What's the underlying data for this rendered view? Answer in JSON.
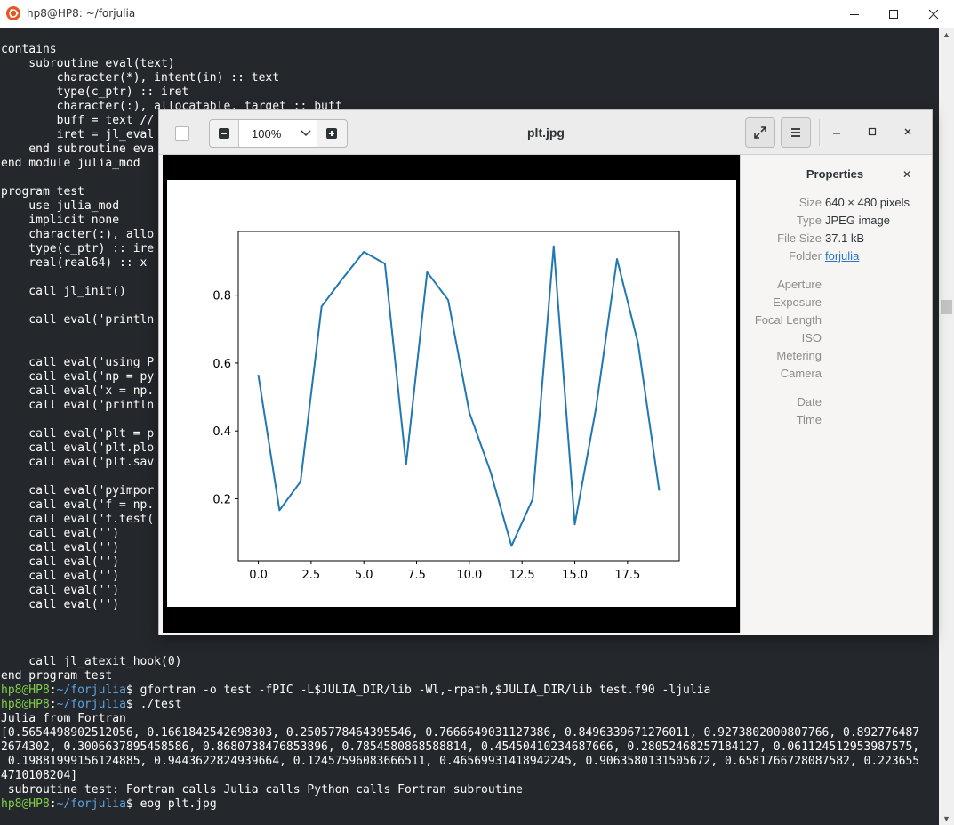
{
  "terminal": {
    "title": "hp8@HP8: ~/forjulia",
    "lines": [
      "contains",
      "    subroutine eval(text)",
      "        character(*), intent(in) :: text",
      "        type(c_ptr) :: iret",
      "        character(:), allocatable, target :: buff",
      "        buff = text //",
      "        iret = jl_eval",
      "    end subroutine eva",
      "end module julia_mod",
      "",
      "program test",
      "    use julia_mod",
      "    implicit none",
      "    character(:), allo",
      "    type(c_ptr) :: ire",
      "    real(real64) :: x",
      "",
      "    call jl_init()",
      "",
      "    call eval('println",
      "",
      "",
      "    call eval('using P",
      "    call eval('np = py",
      "    call eval('x = np.",
      "    call eval('println",
      "",
      "    call eval('plt = p",
      "    call eval('plt.plo",
      "    call eval('plt.sav",
      "",
      "    call eval('pyimpor",
      "    call eval('f = np.",
      "    call eval('f.test(",
      "    call eval('')",
      "    call eval('')",
      "    call eval('')",
      "    call eval('')",
      "    call eval('')",
      "    call eval('')",
      "",
      "",
      "",
      "    call jl_atexit_hook(0)",
      "end program test"
    ],
    "prompt_user": "hp8@HP8",
    "prompt_path": "~/forjulia",
    "prompt_suffix": "$ ",
    "cmd1": "gfortran -o test -fPIC -L$JULIA_DIR/lib -Wl,-rpath,$JULIA_DIR/lib test.f90 -ljulia",
    "cmd2": "./test",
    "output": [
      "Julia from Fortran",
      "[0.5654498902512056, 0.1661842542698303, 0.2505778464395546, 0.7666649031127386, 0.8496339671276011, 0.9273802000807766, 0.892776487",
      "2674302, 0.3006637895458586, 0.8680738476853896, 0.7854580868588814, 0.45450410234687666, 0.28052468257184127, 0.061124512953987575,",
      " 0.1988199915612488​5, 0.9443622824939664, 0.12457596083666511, 0.46569931418942245, 0.9063580131505672, 0.6581766728087582, 0.223655",
      "4710108204]",
      " subroutine test: Fortran calls Julia calls Python calls Fortran subroutine"
    ],
    "cmd3": "eog plt.jpg"
  },
  "viewer": {
    "title": "plt.jpg",
    "zoom": "100%",
    "properties_title": "Properties",
    "props": [
      {
        "label": "Size",
        "value": "640 × 480 pixels"
      },
      {
        "label": "Type",
        "value": "JPEG image"
      },
      {
        "label": "File Size",
        "value": "37.1 kB"
      },
      {
        "label": "Folder",
        "value": "forjulia"
      }
    ],
    "exif_labels": [
      "Aperture",
      "Exposure",
      "Focal Length",
      "ISO",
      "Metering",
      "Camera"
    ],
    "date_labels": [
      "Date",
      "Time"
    ]
  },
  "chart_data": {
    "type": "line",
    "x": [
      0,
      1,
      2,
      3,
      4,
      5,
      6,
      7,
      8,
      9,
      10,
      11,
      12,
      13,
      14,
      15,
      16,
      17,
      18,
      19
    ],
    "values": [
      0.5654,
      0.1662,
      0.2506,
      0.7667,
      0.8496,
      0.9274,
      0.8928,
      0.3007,
      0.8681,
      0.7855,
      0.4545,
      0.2805,
      0.0611,
      0.1988,
      0.9444,
      0.1246,
      0.4657,
      0.9064,
      0.6582,
      0.2237
    ],
    "xticks": [
      "0.0",
      "2.5",
      "5.0",
      "7.5",
      "10.0",
      "12.5",
      "15.0",
      "17.5"
    ],
    "yticks": [
      "0.2",
      "0.4",
      "0.6",
      "0.8"
    ],
    "xlim": [
      -0.95,
      19.95
    ],
    "ylim": [
      0.0177,
      0.9878
    ],
    "line_color": "#1f77b4",
    "grid": false
  }
}
